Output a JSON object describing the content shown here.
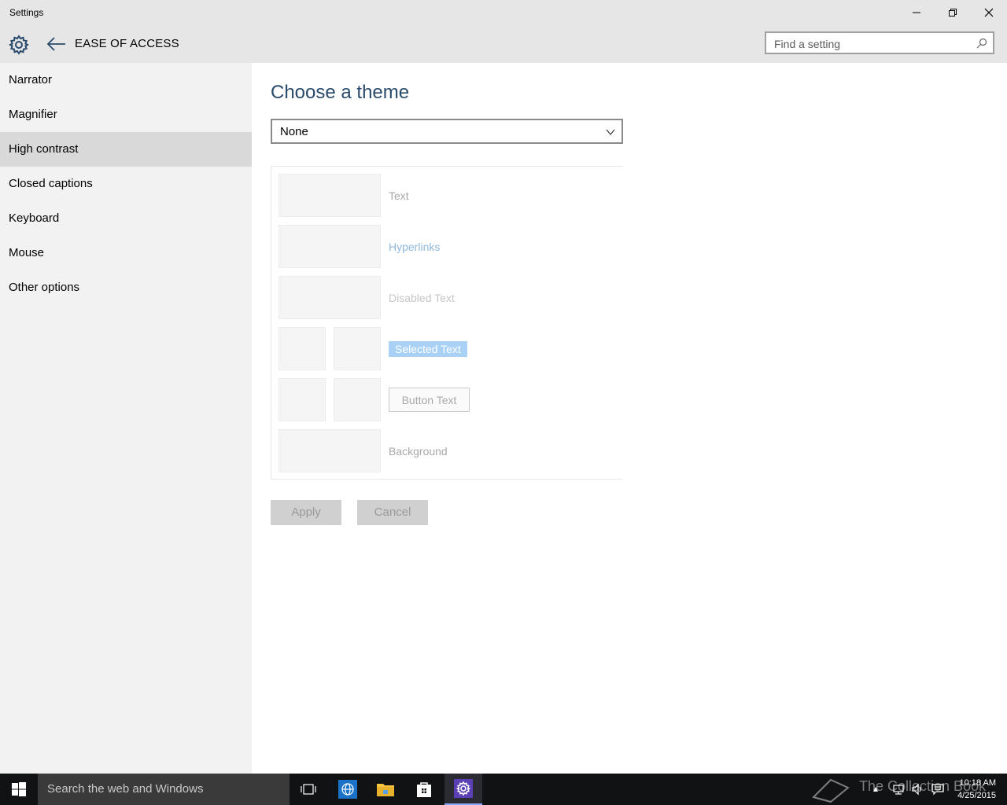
{
  "window": {
    "title": "Settings"
  },
  "header": {
    "section_title": "EASE OF ACCESS",
    "search_placeholder": "Find a setting"
  },
  "sidebar": {
    "items": [
      {
        "label": "Narrator",
        "selected": false
      },
      {
        "label": "Magnifier",
        "selected": false
      },
      {
        "label": "High contrast",
        "selected": true
      },
      {
        "label": "Closed captions",
        "selected": false
      },
      {
        "label": "Keyboard",
        "selected": false
      },
      {
        "label": "Mouse",
        "selected": false
      },
      {
        "label": "Other options",
        "selected": false
      }
    ]
  },
  "main": {
    "heading": "Choose a theme",
    "theme_dropdown": {
      "value": "None"
    },
    "preview": {
      "text_label": "Text",
      "hyperlinks_label": "Hyperlinks",
      "disabled_text_label": "Disabled Text",
      "selected_text_label": "Selected Text",
      "button_text_label": "Button Text",
      "background_label": "Background"
    },
    "apply_label": "Apply",
    "cancel_label": "Cancel"
  },
  "taskbar": {
    "search_text": "Search the web and Windows",
    "watermark": "The Collection Book",
    "time": "10:18 AM",
    "date": "4/25/2015"
  },
  "colors": {
    "accent": "#2a4a6b",
    "sidebar_bg": "#f2f2f2",
    "selected_item": "#d9d9d9",
    "taskbar": "#111214"
  }
}
